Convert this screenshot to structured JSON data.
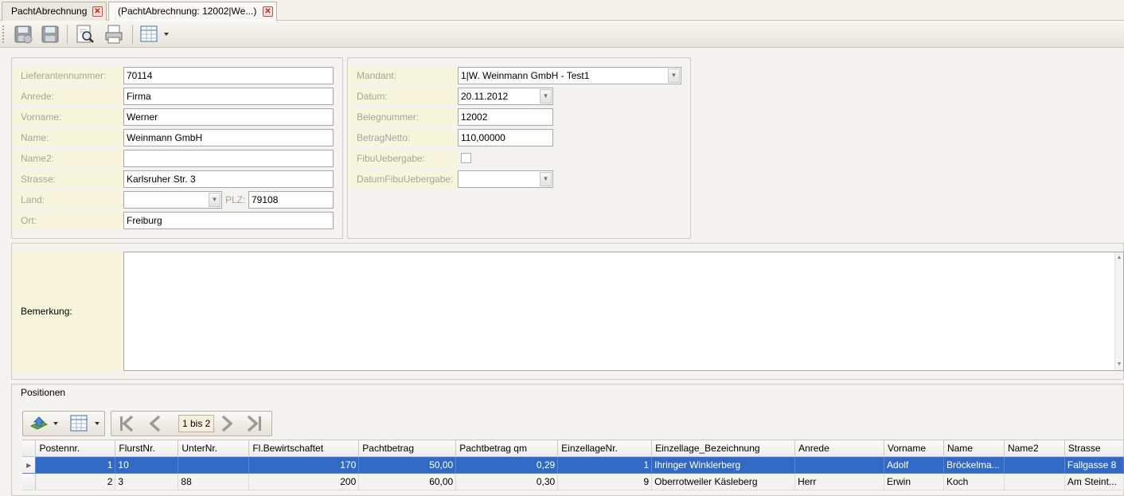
{
  "tabs": [
    {
      "label": "PachtAbrechnung",
      "close": "✕"
    },
    {
      "label": "(PachtAbrechnung: 12002|We...)",
      "close": "✕"
    }
  ],
  "toolbar": {
    "icons": [
      "save-icon",
      "save-all-icon",
      "print-preview-icon",
      "print-icon",
      "grid-layout-icon"
    ]
  },
  "address": {
    "lieferantennummer_label": "Lieferantennummer:",
    "lieferantennummer": "70114",
    "anrede_label": "Anrede:",
    "anrede": "Firma",
    "vorname_label": "Vorname:",
    "vorname": "Werner",
    "name_label": "Name:",
    "name": "Weinmann GmbH",
    "name2_label": "Name2:",
    "name2": "",
    "strasse_label": "Strasse:",
    "strasse": "Karlsruher Str. 3",
    "land_label": "Land:",
    "land": "",
    "plz_label": "PLZ:",
    "plz": "79108",
    "ort_label": "Ort:",
    "ort": "Freiburg"
  },
  "document": {
    "mandant_label": "Mandant:",
    "mandant": "1|W. Weinmann GmbH - Test1",
    "datum_label": "Datum:",
    "datum": "20.11.2012",
    "belegnummer_label": "Belegnummer:",
    "belegnummer": "12002",
    "betragnetto_label": "BetragNetto:",
    "betragnetto": "110,00000",
    "fibuuebergabe_label": "FibuUebergabe:",
    "fibuuebergabe": false,
    "datumfibu_label": "DatumFibuUebergabe:",
    "datumfibu": ""
  },
  "bemerkung": {
    "label": "Bemerkung:",
    "value": ""
  },
  "positionen": {
    "title": "Positionen",
    "pager": "1 bis 2",
    "columns": [
      "Postennr.",
      "FlurstNr.",
      "UnterNr.",
      "Fl.Bewirtschaftet",
      "Pachtbetrag",
      "Pachtbetrag qm",
      "EinzellageNr.",
      "Einzellage_Bezeichnung",
      "Anrede",
      "Vorname",
      "Name",
      "Name2",
      "Strasse"
    ],
    "rows": [
      [
        "1",
        "10",
        "",
        "170",
        "50,00",
        "0,29",
        "1",
        "Ihringer Winklerberg",
        "",
        "Adolf",
        "Bröckelma...",
        "",
        "Fallgasse 8"
      ],
      [
        "2",
        "3",
        "88",
        "200",
        "60,00",
        "0,30",
        "9",
        "Oberrotweiler Käsleberg",
        "Herr",
        "Erwin",
        "Koch",
        "",
        "Am Steint..."
      ]
    ],
    "selected_row": 0
  },
  "colors": {
    "accent": "#3169c6",
    "label_bg": "#f7f6dd"
  }
}
